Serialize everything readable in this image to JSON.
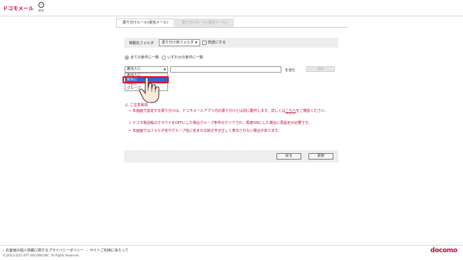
{
  "header": {
    "logo": "ドコモメール",
    "back_label": "戻る",
    "back_glyph": "‹"
  },
  "tabs": [
    {
      "label": "振り分けルール(受信メール)",
      "active": true
    },
    {
      "label": "振り分けルール(送信メール)",
      "active": false
    }
  ],
  "folder_row": {
    "label": "移動先フォルダ",
    "select_value": "振り分け用フォルダ",
    "mark_read_label": "既読にする"
  },
  "match": {
    "all_label": "全ての条件に一致",
    "any_label": "いずれかの条件に一致",
    "selected": "all"
  },
  "condition": {
    "field_value": "差出人に",
    "text_value": "",
    "contains_label": "を含む",
    "delete_label": "削除"
  },
  "dropdown": {
    "items": [
      "差出人に",
      "宛先に",
      "件名に",
      "グループ"
    ],
    "selected_index": 1
  },
  "notes": {
    "title": "ご注意事項",
    "items": [
      {
        "text": "本画面で設定する振り分けは、ドコモメールアプリ内の振り分けとは別に動作します。詳しくは",
        "link": "こちら",
        "after": "をご確認ください。"
      },
      {
        "text": "ドコモ電話帳のクラウドをOFFにした場合グループ条件がクリアされ、再度ONにした場合に再設定が必要です。",
        "link": "",
        "after": ""
      },
      {
        "text": "本画面ではフォルダ名やグループ名に含まれる絵文字が正しく表示されない場合があります。",
        "link": "",
        "after": ""
      }
    ]
  },
  "buttons": {
    "back": "戻る",
    "update": "更新"
  },
  "footer": {
    "privacy_link": "お客様の個人情報に関するプライバシーポリシー",
    "terms_link": "サイトご利用にあたって",
    "copyright": "(C)2013-2015 NTT DOCOMO,INC. All Rights Reserved.",
    "brand": "docomo"
  },
  "colors": {
    "brand": "#cc0033",
    "highlight": "#e0102a",
    "selection": "#3366cc"
  }
}
